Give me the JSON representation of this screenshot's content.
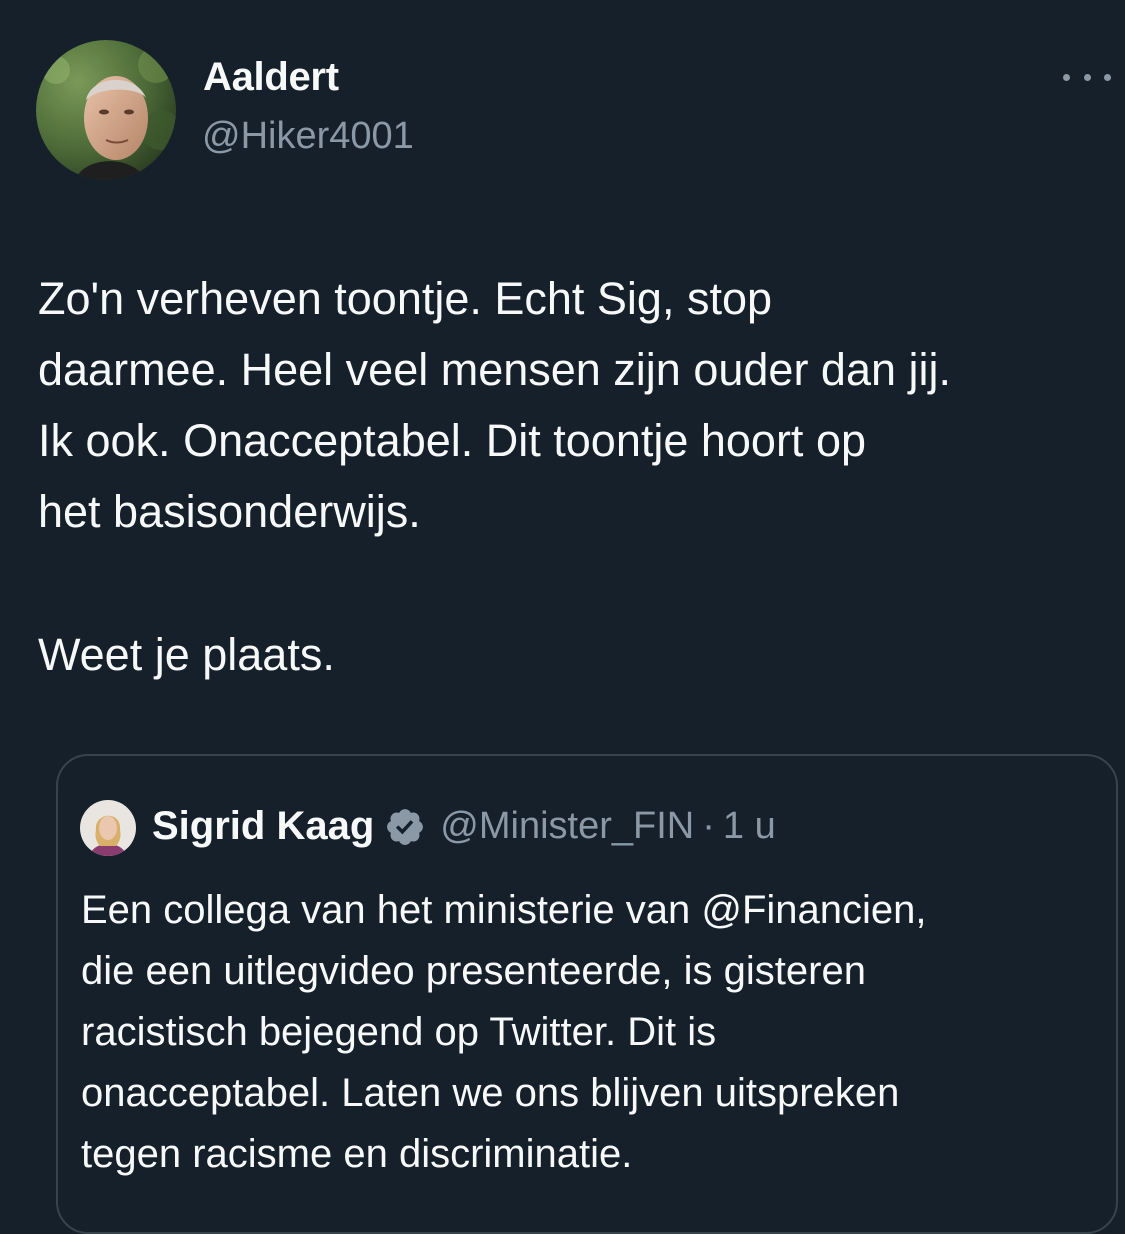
{
  "tweet": {
    "author": {
      "display_name": "Aaldert",
      "handle": "@Hiker4001",
      "avatar_icon": "profile-photo"
    },
    "more_icon": "more-dots-icon",
    "body_lines": [
      "Zo'n verheven toontje. Echt Sig, stop",
      "daarmee. Heel veel mensen zijn ouder dan jij.",
      "Ik ook. Onacceptabel. Dit toontje hoort op",
      "het basisonderwijs."
    ],
    "body_closing": "Weet je plaats."
  },
  "quoted_tweet": {
    "author": {
      "display_name": "Sigrid Kaag",
      "verified_icon": "verified-badge-icon",
      "handle": "@Minister_FIN",
      "separator": "·",
      "time": "1 u"
    },
    "body_lines": [
      "Een collega van het ministerie van @Financien,",
      "die een uitlegvideo presenteerde, is gisteren",
      "racistisch bejegend op Twitter. Dit is",
      "onacceptabel. Laten we ons blijven uitspreken",
      "tegen racisme en discriminatie."
    ]
  },
  "colors": {
    "background": "#15202b",
    "text_primary": "#f7f9f9",
    "text_secondary": "#8b98a5",
    "border": "#38444d",
    "verified_badge": "#8b98a5"
  }
}
